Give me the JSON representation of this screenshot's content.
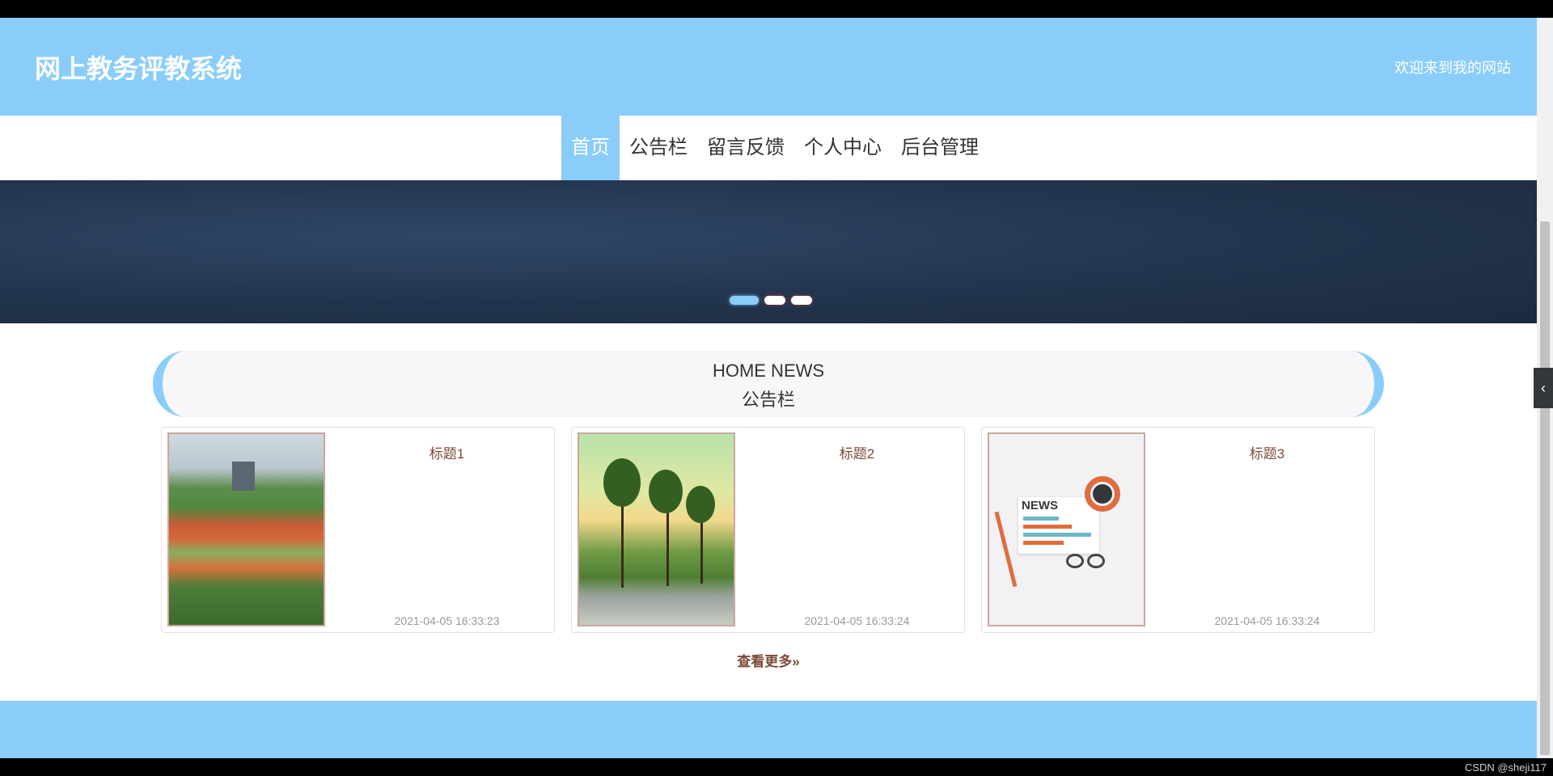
{
  "header": {
    "site_title": "网上教务评教系统",
    "welcome": "欢迎来到我的网站"
  },
  "nav": {
    "items": [
      {
        "label": "首页",
        "active": true
      },
      {
        "label": "公告栏"
      },
      {
        "label": "留言反馈"
      },
      {
        "label": "个人中心"
      },
      {
        "label": "后台管理"
      }
    ]
  },
  "banner": {
    "slides": 3,
    "active_slide": 1
  },
  "news": {
    "title_en": "HOME NEWS",
    "title_cn": "公告栏",
    "cards": [
      {
        "title": "标题1",
        "time": "2021-04-05 16:33:23",
        "image": "sports-field-photo"
      },
      {
        "title": "标题2",
        "time": "2021-04-05 16:33:24",
        "image": "campus-trees-photo"
      },
      {
        "title": "标题3",
        "time": "2021-04-05 16:33:24",
        "image": "news-illustration",
        "image_text": "NEWS"
      }
    ],
    "more_link": "查看更多»"
  },
  "watermark": "CSDN @sheji117",
  "colors": {
    "accent": "#8acdfa",
    "banner": "#22344d",
    "card_title": "#7b4a35"
  }
}
